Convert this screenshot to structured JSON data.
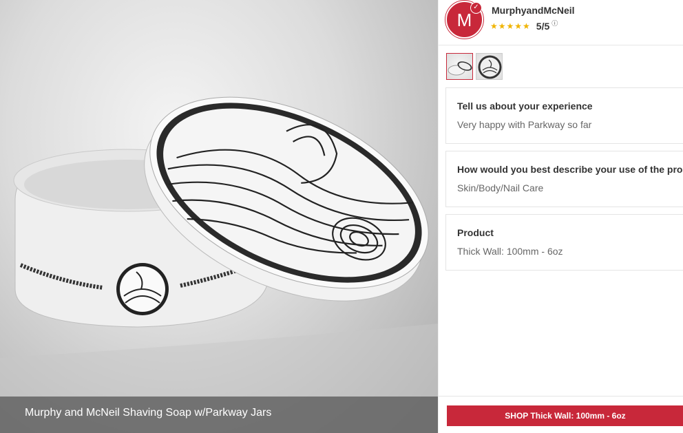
{
  "photo": {
    "caption": "Murphy and McNeil Shaving Soap w/Parkway Jars"
  },
  "profile": {
    "avatar_letter": "M",
    "username": "MurphyandMcNeil",
    "stars": "★★★★★",
    "score": "5/5",
    "info_icon": "info-icon"
  },
  "thumbnails": [
    {
      "name": "thumbnail-1",
      "active": true
    },
    {
      "name": "thumbnail-2",
      "active": false
    }
  ],
  "cards": [
    {
      "title": "Tell us about your experience",
      "value": "Very happy with Parkway so far"
    },
    {
      "title": "How would you best describe your use of the product",
      "value": "Skin/Body/Nail Care"
    },
    {
      "title": "Product",
      "value": "Thick Wall: 100mm - 6oz"
    }
  ],
  "shop_button": {
    "label": "SHOP Thick Wall: 100mm - 6oz"
  },
  "colors": {
    "accent": "#c8283a",
    "stars": "#f0b400"
  }
}
